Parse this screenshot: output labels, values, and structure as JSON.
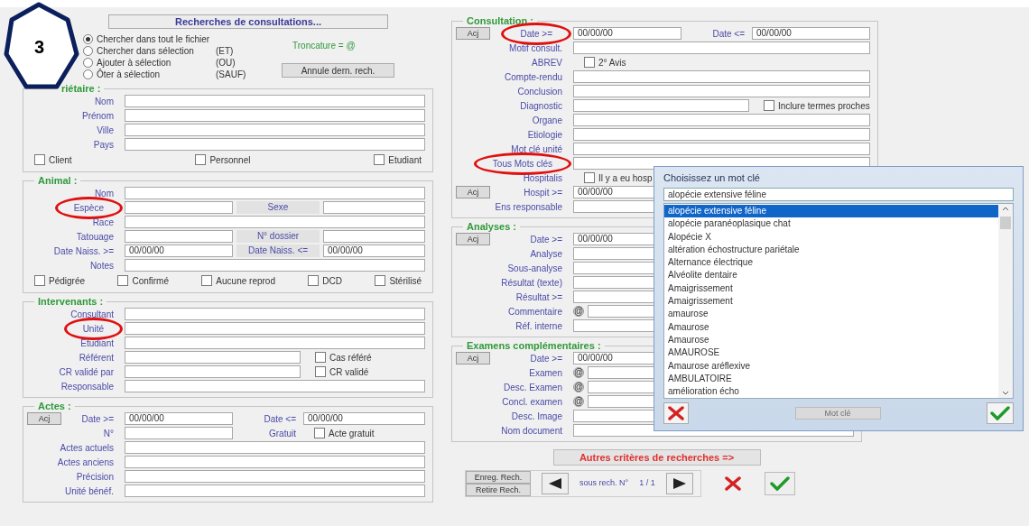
{
  "badge": "3",
  "header": {
    "title_button": "Recherches de consultations...",
    "radios": [
      {
        "label": "Chercher dans tout le fichier",
        "selected": true
      },
      {
        "label": "Chercher dans sélection",
        "suffix": "(ET)",
        "selected": false
      },
      {
        "label": "Ajouter à sélection",
        "suffix": "(OU)",
        "selected": false
      },
      {
        "label": "Ôter à sélection",
        "suffix": "(SAUF)",
        "selected": false
      }
    ],
    "truncation": "Troncature = @",
    "cancel_button": "Annule dern. rech."
  },
  "left_sections": [
    {
      "title": "riétaire :",
      "rows": [
        {
          "label": "Nom",
          "items": [
            {
              "kind": "field"
            }
          ]
        },
        {
          "label": "Prénom",
          "items": [
            {
              "kind": "field"
            }
          ]
        },
        {
          "label": "Ville",
          "items": [
            {
              "kind": "field"
            }
          ]
        },
        {
          "label": "Pays",
          "items": [
            {
              "kind": "field"
            }
          ]
        },
        {
          "kind": "checks",
          "items": [
            {
              "kind": "check",
              "label": "Client",
              "checked": false
            },
            {
              "kind": "check",
              "label": "Personnel",
              "checked": false
            },
            {
              "kind": "check",
              "label": "Etudiant",
              "checked": false
            }
          ]
        }
      ]
    },
    {
      "title": "Animal :",
      "rows": [
        {
          "label": "Nom",
          "items": [
            {
              "kind": "field"
            }
          ]
        },
        {
          "label": "Espèce",
          "circled": true,
          "items": [
            {
              "kind": "short_field"
            },
            {
              "kind": "gray_label",
              "text": "Sexe"
            },
            {
              "kind": "field"
            }
          ]
        },
        {
          "label": "Race",
          "items": [
            {
              "kind": "field"
            }
          ]
        },
        {
          "label": "Tatouage",
          "items": [
            {
              "kind": "short_field"
            },
            {
              "kind": "gray_label",
              "text": "N° dossier"
            },
            {
              "kind": "field"
            }
          ]
        },
        {
          "label": "Date Naiss. >=",
          "items": [
            {
              "kind": "short_field",
              "value": "00/00/00"
            },
            {
              "kind": "gray_label",
              "text": "Date Naiss. <="
            },
            {
              "kind": "field",
              "value": "00/00/00"
            }
          ]
        },
        {
          "label": "Notes",
          "items": [
            {
              "kind": "field"
            }
          ]
        },
        {
          "kind": "checks",
          "items": [
            {
              "kind": "check",
              "label": "Pédigrée",
              "checked": false
            },
            {
              "kind": "check",
              "label": "Confirmé",
              "checked": false
            },
            {
              "kind": "check",
              "label": "Aucune reprod",
              "checked": false
            },
            {
              "kind": "check",
              "label": "DCD",
              "checked": false
            },
            {
              "kind": "check",
              "label": "Stérilisé",
              "checked": false
            }
          ]
        }
      ]
    },
    {
      "title": "Intervenants :",
      "rows": [
        {
          "label": "Consultant",
          "items": [
            {
              "kind": "field"
            }
          ]
        },
        {
          "label": "Unité",
          "circled": true,
          "items": [
            {
              "kind": "field"
            }
          ]
        },
        {
          "label": "Etudiant",
          "items": [
            {
              "kind": "field"
            }
          ]
        },
        {
          "label": "Référent",
          "items": [
            {
              "kind": "wide_field"
            },
            {
              "kind": "check",
              "label": "Cas référé",
              "checked": false
            }
          ]
        },
        {
          "label": "CR validé par",
          "items": [
            {
              "kind": "wide_field"
            },
            {
              "kind": "check",
              "label": "CR validé",
              "checked": false
            }
          ]
        },
        {
          "label": "Responsable",
          "items": [
            {
              "kind": "field"
            }
          ]
        }
      ]
    },
    {
      "title": "Actes :",
      "rows": [
        {
          "button": "Acj",
          "label": "Date >=",
          "items": [
            {
              "kind": "short_field",
              "value": "00/00/00"
            },
            {
              "kind": "sublabel",
              "text": "Date <="
            },
            {
              "kind": "field",
              "value": "00/00/00"
            }
          ]
        },
        {
          "label": "N°",
          "items": [
            {
              "kind": "short_field"
            },
            {
              "kind": "sublabel",
              "text": "Gratuit"
            },
            {
              "kind": "check",
              "label": "Acte gratuit",
              "checked": false
            }
          ]
        },
        {
          "label": "Actes actuels",
          "items": [
            {
              "kind": "field"
            }
          ]
        },
        {
          "label": "Actes anciens",
          "items": [
            {
              "kind": "field"
            }
          ]
        },
        {
          "label": "Précision",
          "items": [
            {
              "kind": "field"
            }
          ]
        },
        {
          "label": "Unité bénéf.",
          "items": [
            {
              "kind": "field"
            }
          ]
        }
      ]
    }
  ],
  "right_sections": [
    {
      "title": "Consultation :",
      "rows": [
        {
          "button": "Acj",
          "label": "Date >=",
          "circled": true,
          "items": [
            {
              "kind": "short_field",
              "value": "00/00/00"
            },
            {
              "kind": "sublabel",
              "text": "Date <="
            },
            {
              "kind": "field",
              "value": "00/00/00"
            }
          ]
        },
        {
          "label": "Motif consult.",
          "items": [
            {
              "kind": "field"
            }
          ]
        },
        {
          "label": "ABREV",
          "items": [
            {
              "kind": "check",
              "label": "2° Avis",
              "checked": false
            }
          ]
        },
        {
          "label": "Compte-rendu",
          "items": [
            {
              "kind": "field"
            }
          ]
        },
        {
          "label": "Conclusion",
          "items": [
            {
              "kind": "field"
            }
          ]
        },
        {
          "label": "Diagnostic",
          "items": [
            {
              "kind": "wide_field"
            },
            {
              "kind": "check",
              "label": "Inclure termes proches",
              "checked": false
            }
          ]
        },
        {
          "label": "Organe",
          "items": [
            {
              "kind": "field"
            }
          ]
        },
        {
          "label": "Etiologie",
          "items": [
            {
              "kind": "field"
            }
          ]
        },
        {
          "label": "Mot clé unité",
          "items": [
            {
              "kind": "field"
            }
          ]
        },
        {
          "label": "Tous Mots clés",
          "circled": true,
          "items": [
            {
              "kind": "field"
            }
          ]
        },
        {
          "label": "Hospitalis",
          "items": [
            {
              "kind": "check",
              "label": "Il y a eu hosp",
              "checked": false
            }
          ]
        },
        {
          "button": "Acj",
          "label": "Hospit >=",
          "items": [
            {
              "kind": "short_field",
              "value": "00/00/00"
            }
          ]
        },
        {
          "label": "Ens responsable",
          "items": [
            {
              "kind": "field"
            }
          ]
        }
      ]
    },
    {
      "title": "Analyses :",
      "rows": [
        {
          "button": "Acj",
          "label": "Date >=",
          "items": [
            {
              "kind": "short_field",
              "value": "00/00/00"
            }
          ]
        },
        {
          "label": "Analyse",
          "items": [
            {
              "kind": "field"
            }
          ]
        },
        {
          "label": "Sous-analyse",
          "items": [
            {
              "kind": "field"
            }
          ]
        },
        {
          "label": "Résultat (texte)",
          "items": [
            {
              "kind": "field"
            }
          ]
        },
        {
          "label": "Résultat >=",
          "items": [
            {
              "kind": "field"
            }
          ]
        },
        {
          "label": "Commentaire",
          "items": [
            {
              "kind": "at",
              "text": "@"
            },
            {
              "kind": "field"
            }
          ]
        },
        {
          "label": "Réf. interne",
          "items": [
            {
              "kind": "field"
            }
          ]
        }
      ]
    },
    {
      "title": "Examens complémentaires :",
      "rows": [
        {
          "button": "Acj",
          "label": "Date >=",
          "items": [
            {
              "kind": "short_field",
              "value": "00/00/00"
            }
          ]
        },
        {
          "label": "Examen",
          "items": [
            {
              "kind": "at",
              "text": "@"
            },
            {
              "kind": "field"
            }
          ]
        },
        {
          "label": "Desc. Examen",
          "items": [
            {
              "kind": "at",
              "text": "@"
            },
            {
              "kind": "field"
            }
          ]
        },
        {
          "label": "Concl. examen",
          "items": [
            {
              "kind": "at",
              "text": "@"
            },
            {
              "kind": "field"
            }
          ]
        },
        {
          "label": "Desc. Image",
          "items": [
            {
              "kind": "field"
            }
          ]
        },
        {
          "label": "Nom document",
          "items": [
            {
              "kind": "field"
            }
          ]
        }
      ]
    }
  ],
  "other_criteria_button": "Autres critères de recherches =>",
  "search_nav": {
    "save_button": "Enreg. Rech.",
    "remove_button": "Retire Rech.",
    "label": "sous rech. N°",
    "counter": "1 / 1"
  },
  "dialog": {
    "title": "Choisissez un mot clé",
    "input_value": "alopécie extensive féline",
    "items": [
      {
        "text": "alopécie extensive féline",
        "selected": true
      },
      {
        "text": "alopécie paranéoplasique chat",
        "selected": false
      },
      {
        "text": "Alopécie X",
        "selected": false
      },
      {
        "text": "altération échostructure pariétale",
        "selected": false
      },
      {
        "text": "Alternance électrique",
        "selected": false
      },
      {
        "text": "Alvéolite dentaire",
        "selected": false
      },
      {
        "text": "Amaigrissement",
        "selected": false
      },
      {
        "text": "Amaigrissement",
        "selected": false
      },
      {
        "text": "amaurose",
        "selected": false
      },
      {
        "text": "Amaurose",
        "selected": false
      },
      {
        "text": "Amaurose",
        "selected": false
      },
      {
        "text": "AMAUROSE",
        "selected": false
      },
      {
        "text": "Amaurose aréflexive",
        "selected": false
      },
      {
        "text": "AMBULATOIRE",
        "selected": false
      },
      {
        "text": "amélioration écho",
        "selected": false
      }
    ],
    "middle_button": {
      "label": "Mot clé",
      "disabled": true
    }
  }
}
